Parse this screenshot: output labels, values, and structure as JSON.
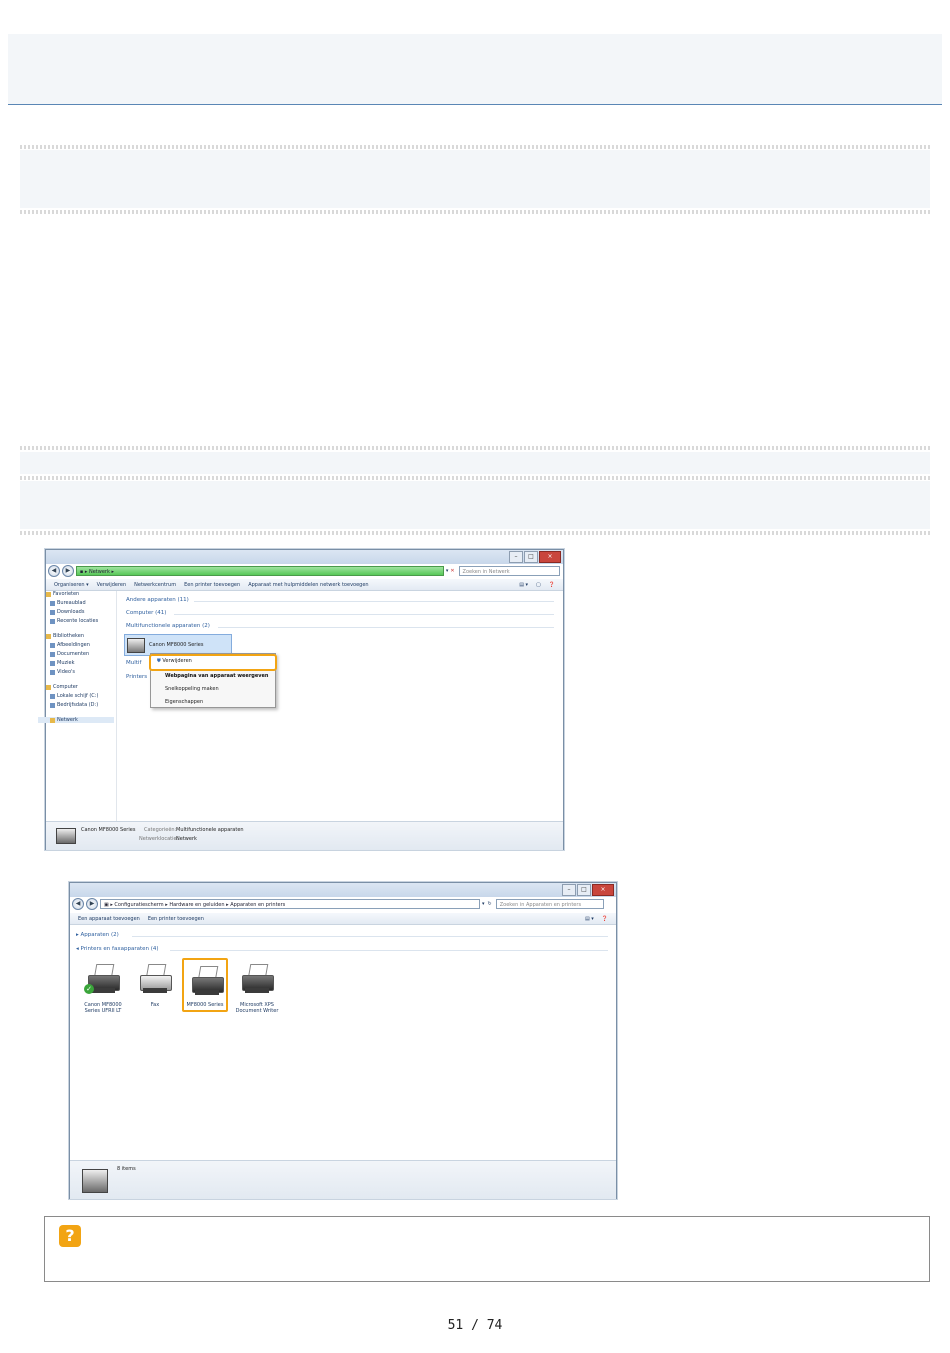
{
  "page": {
    "number_label": "51 / 74"
  },
  "screenshot1": {
    "address_path": "Netwerk",
    "search_placeholder": "Zoeken in Netwerk",
    "toolbar": [
      "Organiseren ▾",
      "Verwijderen",
      "Netwerkcentrum",
      "Een printer toevoegen",
      "Apparaat met hulpmiddelen netwerk toevoegen"
    ],
    "sidebar": [
      {
        "label": "Favorieten",
        "icon": "star-icon",
        "header": true
      },
      {
        "label": "Bureaublad",
        "icon": "desktop-icon",
        "header": false
      },
      {
        "label": "Downloads",
        "icon": "downloads-icon",
        "header": false
      },
      {
        "label": "Recente locaties",
        "icon": "recent-icon",
        "header": false
      },
      {
        "label": "Bibliotheken",
        "icon": "library-icon",
        "header": true
      },
      {
        "label": "Afbeeldingen",
        "icon": "pictures-icon",
        "header": false
      },
      {
        "label": "Documenten",
        "icon": "documents-icon",
        "header": false
      },
      {
        "label": "Muziek",
        "icon": "music-icon",
        "header": false
      },
      {
        "label": "Video's",
        "icon": "video-icon",
        "header": false
      },
      {
        "label": "Computer",
        "icon": "computer-icon",
        "header": true
      },
      {
        "label": "Lokale schijf (C:)",
        "icon": "drive-icon",
        "header": false
      },
      {
        "label": "Bedrijfsdata (D:)",
        "icon": "drive-icon",
        "header": false
      },
      {
        "label": "Netwerk",
        "icon": "network-icon",
        "header": true
      }
    ],
    "groups": [
      "Andere apparaten (11)",
      "Computer (41)",
      "Multifunctionele apparaten (2)",
      "Multif",
      "Printers"
    ],
    "device_label": "Canon MF8000 Series",
    "context_menu": [
      "Verwijderen",
      "Webpagina van apparaat weergeven",
      "Snelkoppeling maken",
      "Eigenschappen"
    ],
    "status": {
      "name": "Canon MF8000 Series",
      "category_label": "Categorieën:",
      "category_value": "Multifunctionele apparaten",
      "network_label": "Netwerklocatie:",
      "network_value": "Netwerk"
    }
  },
  "screenshot2": {
    "address_path": [
      "Configuratiescherm",
      "Hardware en geluiden",
      "Apparaten en printers"
    ],
    "search_placeholder": "Zoeken in Apparaten en printers",
    "toolbar": [
      "Een apparaat toevoegen",
      "Een printer toevoegen"
    ],
    "groups": [
      "Apparaten (2)",
      "Printers en faxapparaten (4)"
    ],
    "printers": [
      {
        "label": "Canon MF8000 Series UFRII LT",
        "default": true,
        "selected": false
      },
      {
        "label": "Fax",
        "default": false,
        "selected": false
      },
      {
        "label": "MF8000 Series",
        "default": false,
        "selected": true
      },
      {
        "label": "Microsoft XPS Document Writer",
        "default": false,
        "selected": false
      }
    ],
    "status_text": "8 items"
  },
  "colors": {
    "accent": "#f2a413",
    "rule": "#5a86b5",
    "link": "#2e5f9e"
  }
}
